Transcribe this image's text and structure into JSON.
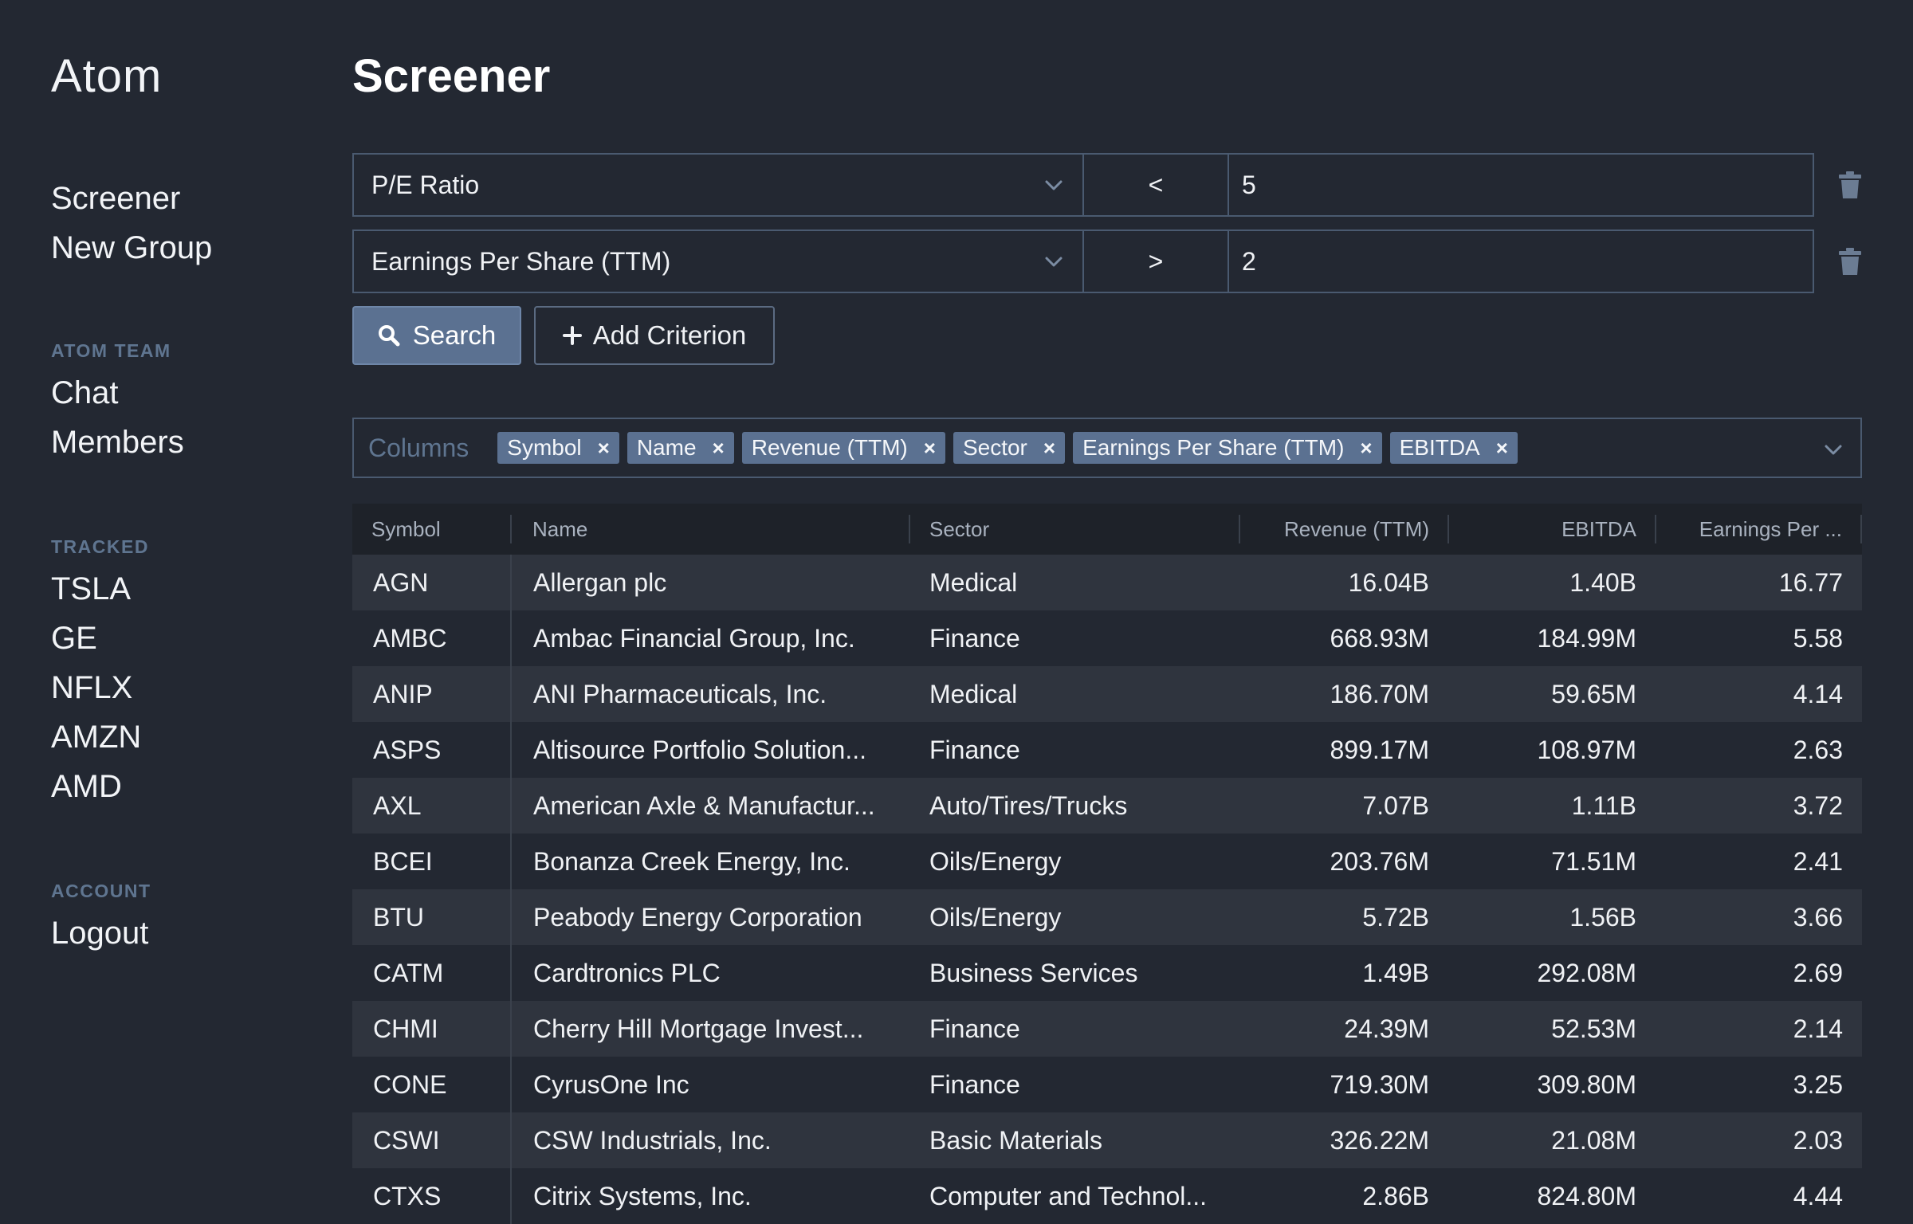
{
  "app": {
    "name": "Atom"
  },
  "sidebar": {
    "main_nav": [
      {
        "label": "Screener",
        "id": "screener"
      },
      {
        "label": "New Group",
        "id": "new-group"
      }
    ],
    "team": {
      "heading": "ATOM TEAM",
      "items": [
        {
          "label": "Chat",
          "id": "chat"
        },
        {
          "label": "Members",
          "id": "members"
        }
      ]
    },
    "tracked": {
      "heading": "TRACKED",
      "items": [
        {
          "label": "TSLA",
          "id": "tsla"
        },
        {
          "label": "GE",
          "id": "ge"
        },
        {
          "label": "NFLX",
          "id": "nflx"
        },
        {
          "label": "AMZN",
          "id": "amzn"
        },
        {
          "label": "AMD",
          "id": "amd"
        }
      ]
    },
    "account": {
      "heading": "ACCOUNT",
      "items": [
        {
          "label": "Logout",
          "id": "logout"
        }
      ]
    }
  },
  "page": {
    "title": "Screener"
  },
  "criteria": [
    {
      "field": "P/E Ratio",
      "operator": "<",
      "value": "5"
    },
    {
      "field": "Earnings Per Share (TTM)",
      "operator": ">",
      "value": "2"
    }
  ],
  "actions": {
    "search_label": "Search",
    "add_label": "Add Criterion"
  },
  "columns_selector": {
    "label": "Columns",
    "tags": [
      "Symbol",
      "Name",
      "Revenue (TTM)",
      "Sector",
      "Earnings Per Share (TTM)",
      "EBITDA"
    ],
    "remove_glyph": "×"
  },
  "table": {
    "headers": {
      "symbol": "Symbol",
      "name": "Name",
      "sector": "Sector",
      "revenue": "Revenue (TTM)",
      "ebitda": "EBITDA",
      "eps": "Earnings Per ..."
    },
    "rows": [
      {
        "symbol": "AGN",
        "name": "Allergan plc",
        "sector": "Medical",
        "revenue": "16.04B",
        "ebitda": "1.40B",
        "eps": "16.77"
      },
      {
        "symbol": "AMBC",
        "name": "Ambac Financial Group, Inc.",
        "sector": "Finance",
        "revenue": "668.93M",
        "ebitda": "184.99M",
        "eps": "5.58"
      },
      {
        "symbol": "ANIP",
        "name": "ANI Pharmaceuticals, Inc.",
        "sector": "Medical",
        "revenue": "186.70M",
        "ebitda": "59.65M",
        "eps": "4.14"
      },
      {
        "symbol": "ASPS",
        "name": "Altisource Portfolio Solution...",
        "sector": "Finance",
        "revenue": "899.17M",
        "ebitda": "108.97M",
        "eps": "2.63"
      },
      {
        "symbol": "AXL",
        "name": "American Axle & Manufactur...",
        "sector": "Auto/Tires/Trucks",
        "revenue": "7.07B",
        "ebitda": "1.11B",
        "eps": "3.72"
      },
      {
        "symbol": "BCEI",
        "name": "Bonanza Creek Energy, Inc.",
        "sector": "Oils/Energy",
        "revenue": "203.76M",
        "ebitda": "71.51M",
        "eps": "2.41"
      },
      {
        "symbol": "BTU",
        "name": "Peabody Energy Corporation",
        "sector": "Oils/Energy",
        "revenue": "5.72B",
        "ebitda": "1.56B",
        "eps": "3.66"
      },
      {
        "symbol": "CATM",
        "name": "Cardtronics PLC",
        "sector": "Business Services",
        "revenue": "1.49B",
        "ebitda": "292.08M",
        "eps": "2.69"
      },
      {
        "symbol": "CHMI",
        "name": "Cherry Hill Mortgage Invest...",
        "sector": "Finance",
        "revenue": "24.39M",
        "ebitda": "52.53M",
        "eps": "2.14"
      },
      {
        "symbol": "CONE",
        "name": "CyrusOne Inc",
        "sector": "Finance",
        "revenue": "719.30M",
        "ebitda": "309.80M",
        "eps": "3.25"
      },
      {
        "symbol": "CSWI",
        "name": "CSW Industrials, Inc.",
        "sector": "Basic Materials",
        "revenue": "326.22M",
        "ebitda": "21.08M",
        "eps": "2.03"
      },
      {
        "symbol": "CTXS",
        "name": "Citrix Systems, Inc.",
        "sector": "Computer and Technol...",
        "revenue": "2.86B",
        "ebitda": "824.80M",
        "eps": "4.44"
      }
    ]
  },
  "colors": {
    "background": "#232832",
    "accent": "#5b7191",
    "heading_muted": "#5f7590",
    "border": "#4a5a70"
  }
}
